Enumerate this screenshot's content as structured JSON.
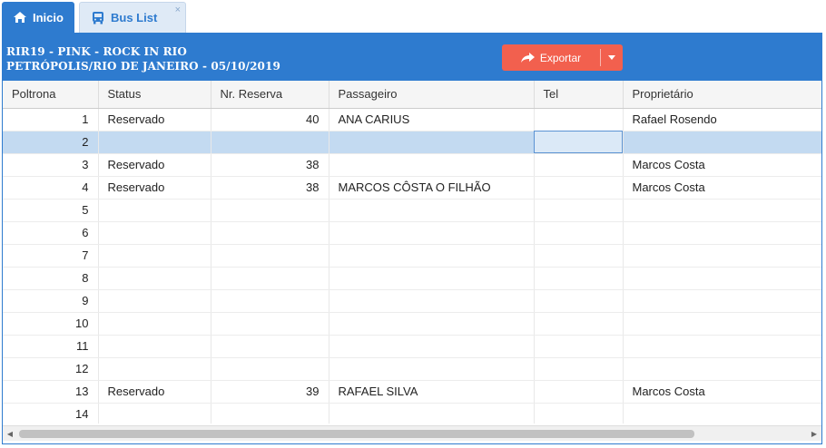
{
  "tabs": [
    {
      "label": "Inicio",
      "icon": "home-icon",
      "active": false
    },
    {
      "label": "Bus List",
      "icon": "bus-icon",
      "active": true,
      "close": "×"
    }
  ],
  "header": {
    "line1": "RIR19 - PINK - ROCK IN RIO",
    "line2": "PETRÓPOLIS/RIO DE JANEIRO - 05/10/2019"
  },
  "export_button": {
    "label": "Exportar",
    "icon": "share-arrow-icon",
    "caret": "caret-down-icon"
  },
  "columns": [
    "Poltrona",
    "Status",
    "Nr. Reserva",
    "Passageiro",
    "Tel",
    "Proprietário"
  ],
  "rows": [
    [
      "1",
      "Reservado",
      "40",
      "ANA CARIUS",
      "",
      "Rafael Rosendo"
    ],
    [
      "2",
      "",
      "",
      "",
      "",
      ""
    ],
    [
      "3",
      "Reservado",
      "38",
      "",
      "",
      "Marcos Costa"
    ],
    [
      "4",
      "Reservado",
      "38",
      "MARCOS CÔSTA O FILHÃO",
      "",
      "Marcos Costa"
    ],
    [
      "5",
      "",
      "",
      "",
      "",
      ""
    ],
    [
      "6",
      "",
      "",
      "",
      "",
      ""
    ],
    [
      "7",
      "",
      "",
      "",
      "",
      ""
    ],
    [
      "8",
      "",
      "",
      "",
      "",
      ""
    ],
    [
      "9",
      "",
      "",
      "",
      "",
      ""
    ],
    [
      "10",
      "",
      "",
      "",
      "",
      ""
    ],
    [
      "11",
      "",
      "",
      "",
      "",
      ""
    ],
    [
      "12",
      "",
      "",
      "",
      "",
      ""
    ],
    [
      "13",
      "Reservado",
      "39",
      "RAFAEL SILVA",
      "",
      "Marcos Costa"
    ],
    [
      "14",
      "",
      "",
      "",
      "",
      ""
    ]
  ],
  "selected_row": 1,
  "colors": {
    "accent": "#2e7bcf",
    "export": "#f2604e",
    "selected_row": "#c3daf1"
  }
}
